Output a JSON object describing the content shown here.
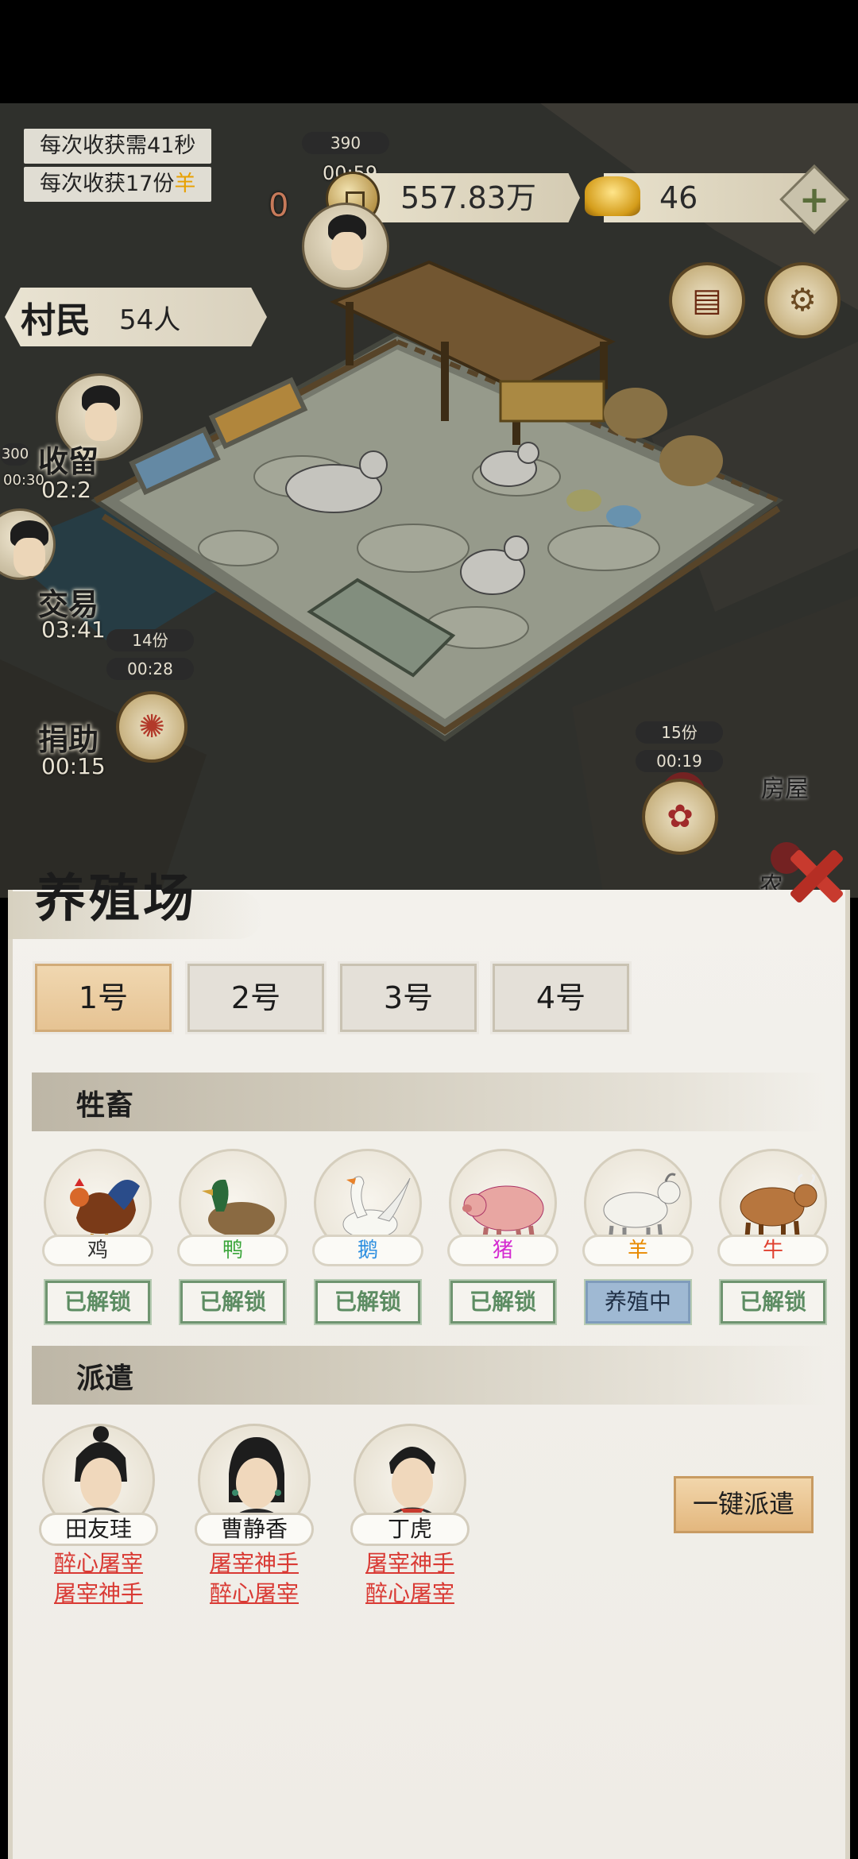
{
  "hud": {
    "harvest_time": "每次收获需41秒",
    "harvest_amount_prefix": "每次收获17份",
    "harvest_amount_animal": "羊",
    "villager_label": "村民",
    "villager_count": "54人",
    "coins": "557.83万",
    "ingots": "46",
    "plus": "+",
    "top_bubble": "390",
    "top_timer": "00:59",
    "bg_number": "0"
  },
  "side_menu": [
    {
      "label": "收留",
      "timer": "02:2",
      "badge": "300",
      "badge2": "00:30"
    },
    {
      "label": "交易",
      "timer": "03:41"
    },
    {
      "label": "捐助",
      "timer": "00:15"
    }
  ],
  "scene_tags": {
    "left_count": "14份",
    "left_time": "00:28",
    "right_count": "15份",
    "right_time": "00:19",
    "house": "房屋",
    "house_partial": "农"
  },
  "panel": {
    "title": "养殖场",
    "tabs": [
      "1号",
      "2号",
      "3号",
      "4号"
    ],
    "active_tab": 0,
    "livestock_header": "牲畜",
    "dispatch_header": "派遣",
    "one_click": "一键派遣"
  },
  "animals": [
    {
      "name": "鸡",
      "status": "已解锁",
      "name_color": "#333333",
      "icon": "rooster-icon"
    },
    {
      "name": "鸭",
      "status": "已解锁",
      "name_color": "#3aa53a",
      "icon": "duck-icon"
    },
    {
      "name": "鹅",
      "status": "已解锁",
      "name_color": "#2e8fe0",
      "icon": "goose-icon"
    },
    {
      "name": "猪",
      "status": "已解锁",
      "name_color": "#d42ad0",
      "icon": "pig-icon"
    },
    {
      "name": "羊",
      "status": "养殖中",
      "name_color": "#e88a00",
      "icon": "goat-icon"
    },
    {
      "name": "牛",
      "status": "已解锁",
      "name_color": "#e0402f",
      "icon": "cow-icon"
    }
  ],
  "workers": [
    {
      "name": "田友珪",
      "skills": [
        "醉心屠宰",
        "屠宰神手"
      ]
    },
    {
      "name": "曹静香",
      "skills": [
        "屠宰神手",
        "醉心屠宰"
      ]
    },
    {
      "name": "丁虎",
      "skills": [
        "屠宰神手",
        "醉心屠宰"
      ]
    }
  ],
  "colors": {
    "accent_tab": "#e6c393",
    "unlocked_green": "#5c8c62",
    "breeding_blue": "#9fb9d3",
    "skill_red": "#d93a34",
    "close_red": "#c83a2e"
  }
}
